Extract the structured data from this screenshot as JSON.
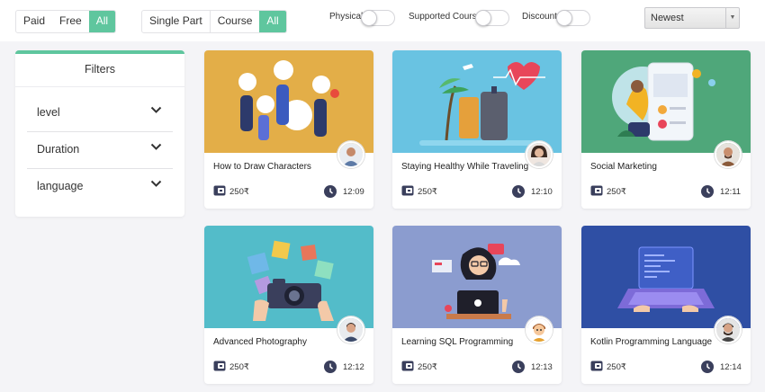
{
  "toolbar": {
    "type_filter": [
      "Paid",
      "Free",
      "All"
    ],
    "part_filter": [
      "Single Part",
      "Course",
      "All"
    ],
    "toggles": [
      "Physical",
      "Supported Course",
      "Discount"
    ],
    "sort": {
      "selected": "Newest"
    }
  },
  "filters": {
    "title": "Filters",
    "items": [
      "level",
      "Duration",
      "language"
    ]
  },
  "courses": [
    {
      "title": "How to Draw Characters",
      "price": "250₹",
      "duration": "12:09",
      "thumb_color": "#e3ae48"
    },
    {
      "title": "Staying Healthy While Traveling",
      "price": "250₹",
      "duration": "12:10",
      "thumb_color": "#69c3e2"
    },
    {
      "title": "Social Marketing",
      "price": "250₹",
      "duration": "12:11",
      "thumb_color": "#4fa77a"
    },
    {
      "title": "Advanced Photography",
      "price": "250₹",
      "duration": "12:12",
      "thumb_color": "#53bcc9"
    },
    {
      "title": "Learning SQL Programming",
      "price": "250₹",
      "duration": "12:13",
      "thumb_color": "#8b9ccf"
    },
    {
      "title": "Kotlin Programming Language",
      "price": "250₹",
      "duration": "12:14",
      "thumb_color": "#2f4fa4"
    }
  ],
  "colors": {
    "accent": "#5fc69e",
    "icon": "#3a3f5c"
  }
}
